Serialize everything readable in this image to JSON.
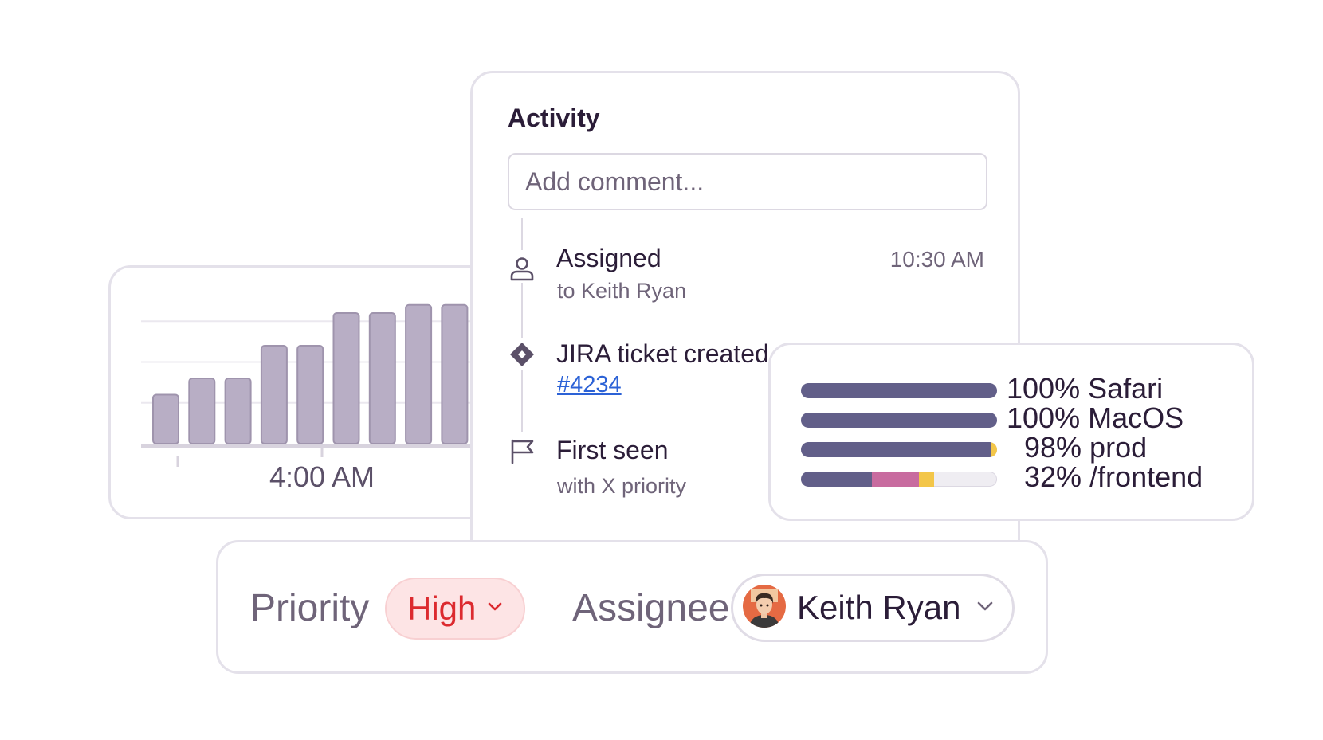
{
  "chart_data": {
    "type": "bar",
    "values": [
      6,
      8,
      8,
      12,
      12,
      16,
      16,
      17,
      17
    ],
    "ylim": [
      0,
      20
    ],
    "xlabel": "",
    "ylabel": "",
    "tick_labels": [
      "4:00 AM"
    ],
    "grid": true,
    "bar_color": "#b8aec5"
  },
  "activity": {
    "title": "Activity",
    "comment_placeholder": "Add comment...",
    "items": [
      {
        "icon": "user-icon",
        "title": "Assigned",
        "subtitle": "to Keith Ryan",
        "time": "10:30 AM"
      },
      {
        "icon": "jira-diamond-icon",
        "title": "JIRA ticket created",
        "link": "#4234"
      },
      {
        "icon": "flag-icon",
        "title": "First seen",
        "subtitle": "with X priority"
      }
    ]
  },
  "tags": [
    {
      "label": "100% Safari",
      "segments": [
        {
          "percent": 100,
          "color": "#625f89"
        }
      ]
    },
    {
      "label": "100% MacOS",
      "segments": [
        {
          "percent": 100,
          "color": "#625f89"
        }
      ]
    },
    {
      "label": "98% prod",
      "segments": [
        {
          "percent": 97,
          "color": "#625f89"
        },
        {
          "percent": 3,
          "color": "#f3c649"
        }
      ]
    },
    {
      "label": "32% /frontend",
      "segments": [
        {
          "percent": 36,
          "color": "#625f89"
        },
        {
          "percent": 24,
          "color": "#c86b9f"
        },
        {
          "percent": 8,
          "color": "#f3c649"
        }
      ]
    }
  ],
  "fields": {
    "priority_label": "Priority",
    "priority_value": "High",
    "assignee_label": "Assignee",
    "assignee_name": "Keith Ryan"
  },
  "colors": {
    "accent_red": "#dc2a2f",
    "link_blue": "#2c62d6",
    "border": "#e4e1ea"
  }
}
